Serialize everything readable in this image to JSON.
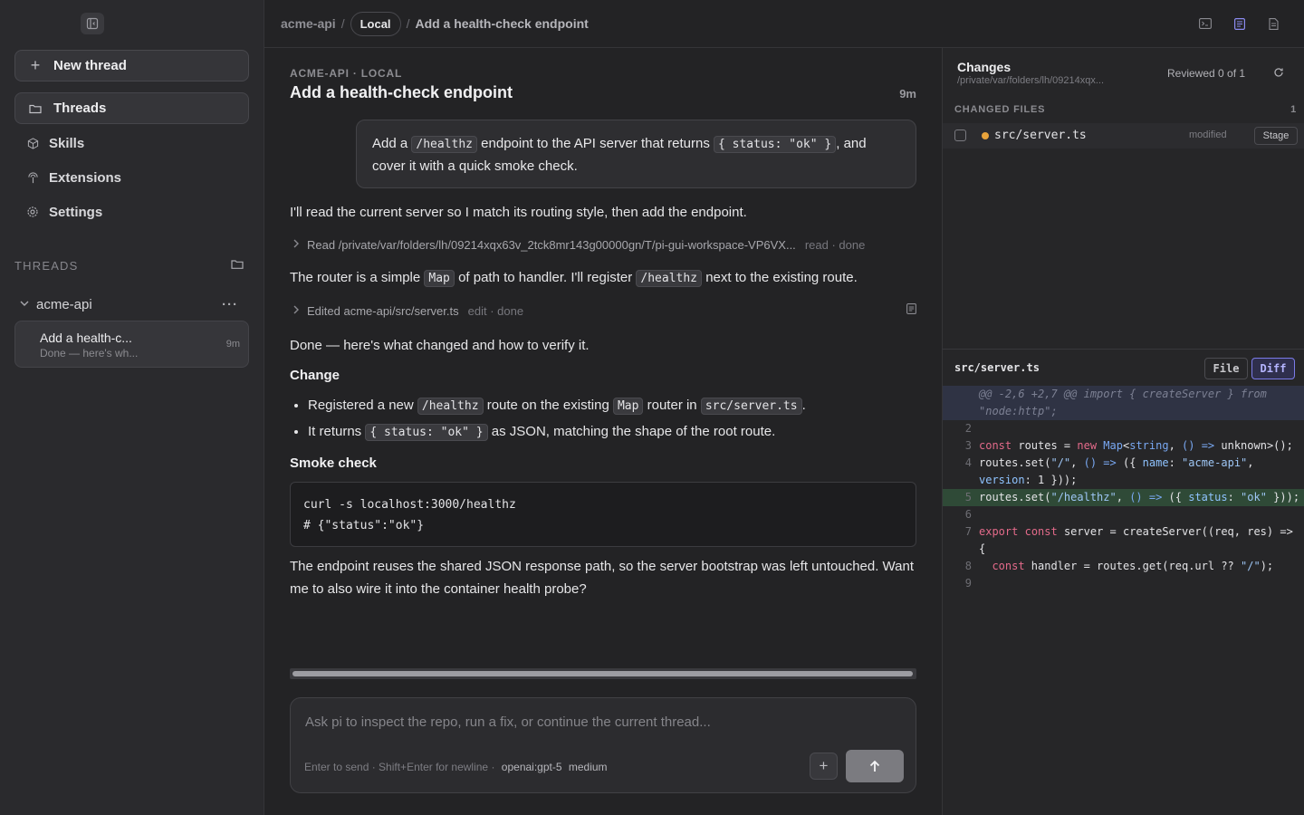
{
  "sidebar": {
    "new_thread": "New thread",
    "nav": [
      {
        "label": "Threads",
        "icon": "folder-icon"
      },
      {
        "label": "Skills",
        "icon": "cube-icon"
      },
      {
        "label": "Extensions",
        "icon": "plug-icon"
      },
      {
        "label": "Settings",
        "icon": "gear-icon"
      }
    ],
    "threads_header": "THREADS",
    "repo": "acme-api",
    "thread": {
      "title": "Add a health-c...",
      "preview": "Done — here's wh...",
      "age": "9m"
    }
  },
  "topbar": {
    "repo": "acme-api",
    "sep": "/",
    "env": "Local",
    "title": "Add a health-check endpoint"
  },
  "chat": {
    "subtitle": "ACME-API · LOCAL",
    "title": "Add a health-check endpoint",
    "age": "9m",
    "user_message": {
      "t1": "Add a",
      "code1": "/healthz",
      "t2": "endpoint to the API server that returns",
      "code2": "{ status: \"ok\" }",
      "t3": ", and cover it with a quick smoke check."
    },
    "msg1": "I'll read the current server so I match its routing style, then add the endpoint.",
    "tool_read": {
      "label": "Read /private/var/folders/lh/09214xqx63v_2tck8mr143g00000gn/T/pi-gui-workspace-VP6VX...",
      "status": "read · done"
    },
    "msg2": {
      "t1": "The router is a simple",
      "code1": "Map",
      "t2": "of path to handler. I'll register",
      "code2": "/healthz",
      "t3": "next to the existing route."
    },
    "tool_edit": {
      "label": "Edited acme-api/src/server.ts",
      "status": "edit · done"
    },
    "msg3": "Done — here's what changed and how to verify it.",
    "heading_change": "Change",
    "bullet1": {
      "t1": "Registered a new",
      "code1": "/healthz",
      "t2": "route on the existing",
      "code2": "Map",
      "t3": "router in",
      "code3": "src/server.ts",
      "t4": "."
    },
    "bullet2": {
      "t1": "It returns",
      "code1": "{ status: \"ok\" }",
      "t2": "as JSON, matching the shape of the root route."
    },
    "heading_smoke": "Smoke check",
    "code_line1": "curl -s localhost:3000/healthz",
    "code_line2": "# {\"status\":\"ok\"}",
    "msg4": "The endpoint reuses the shared JSON response path, so the server bootstrap was left untouched. Want me to also wire it into the container health probe?"
  },
  "composer": {
    "placeholder": "Ask pi to inspect the repo, run a fix, or continue the current thread...",
    "hint": "Enter to send · Shift+Enter for newline ·",
    "model": "openai:gpt-5",
    "effort": "medium",
    "attach": "+",
    "send": "↑"
  },
  "changes": {
    "title": "Changes",
    "path": "/private/var/folders/lh/09214xqx...",
    "reviewed": "Reviewed 0 of 1",
    "files_header": "CHANGED FILES",
    "files_count": "1",
    "file": {
      "name": "src/server.ts",
      "status": "modified",
      "stage": "Stage"
    },
    "diff_file": "src/server.ts",
    "view_file": "File",
    "view_diff": "Diff",
    "diff_lines": [
      {
        "n": "",
        "kind": "hunk",
        "text": "@@ -2,6 +2,7 @@ import { createServer } from \"node:http\";"
      },
      {
        "n": "2",
        "kind": "ctx",
        "text": ""
      },
      {
        "n": "3",
        "kind": "ctx",
        "text": "const routes = new Map<string, () => unknown>();"
      },
      {
        "n": "4",
        "kind": "ctx",
        "text": "routes.set(\"/\", () => ({ name: \"acme-api\", version: 1 }));"
      },
      {
        "n": "5",
        "kind": "add",
        "text": "routes.set(\"/healthz\", () => ({ status: \"ok\" }));"
      },
      {
        "n": "6",
        "kind": "ctx",
        "text": ""
      },
      {
        "n": "7",
        "kind": "ctx",
        "text": "export const server = createServer((req, res) => {"
      },
      {
        "n": "8",
        "kind": "ctx",
        "text": "  const handler = routes.get(req.url ?? \"/\");"
      },
      {
        "n": "9",
        "kind": "ctx",
        "text": ""
      }
    ]
  },
  "colors": {
    "accent": "#7b7be8",
    "added": "#2f4a37",
    "hunk": "#2f3344",
    "modified_dot": "#e8a33b"
  }
}
